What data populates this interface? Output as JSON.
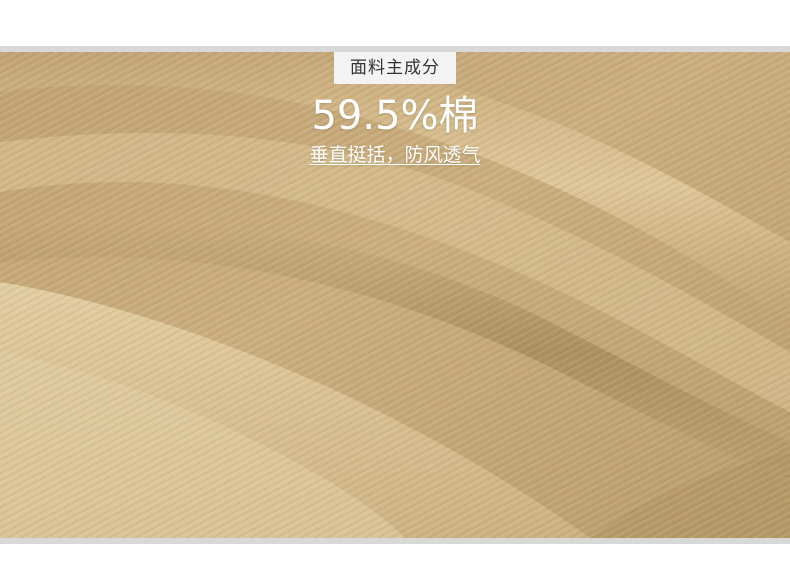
{
  "image": {
    "subject": "fabric-closeup",
    "colors": {
      "fabric_base": "#c8ae80",
      "fabric_light": "#dcc596",
      "fabric_dark": "#a98c5c",
      "divider": "#d8d8d8",
      "tag_background": "#f3f3f3",
      "overlay_text": "#ffffff"
    }
  },
  "overlay": {
    "tag_label": "面料主成分",
    "headline": "59.5%棉",
    "subline": "垂直挺括，防风透气"
  }
}
